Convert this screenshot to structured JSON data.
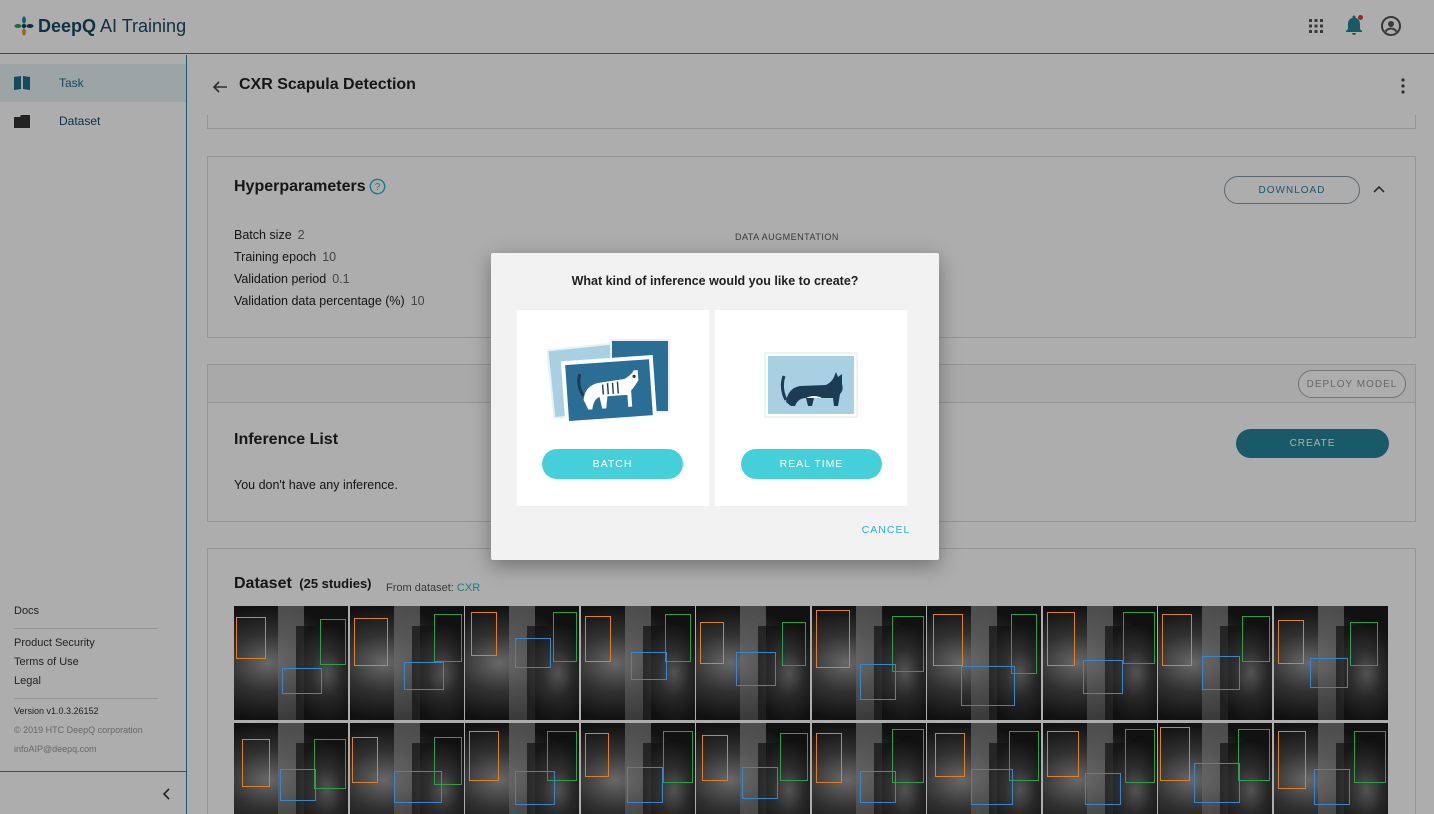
{
  "topbar": {
    "brand": "DeepQ",
    "product": "AI Training"
  },
  "sidebar": {
    "items": [
      {
        "label": "Task",
        "icon": "book-icon"
      },
      {
        "label": "Dataset",
        "icon": "folder-icon"
      }
    ],
    "links": [
      "Docs",
      "Product Security",
      "Terms of Use",
      "Legal"
    ],
    "version": "Version v1.0.3.26152",
    "copyright": "© 2019 HTC DeepQ corporation",
    "email": "infoAIP@deepq.com"
  },
  "header": {
    "title": "CXR Scapula Detection"
  },
  "hyperparameters": {
    "title": "Hyperparameters",
    "download_label": "DOWNLOAD",
    "params": [
      {
        "key": "Batch size",
        "value": "2"
      },
      {
        "key": "Training epoch",
        "value": "10"
      },
      {
        "key": "Validation period",
        "value": "0.1"
      },
      {
        "key": "Validation data percentage (%)",
        "value": "10"
      }
    ],
    "augmentation_label": "DATA AUGMENTATION"
  },
  "deploy": {
    "label": "DEPLOY MODEL"
  },
  "inference": {
    "title": "Inference List",
    "create_label": "CREATE",
    "empty_text": "You don't have any inference."
  },
  "dataset": {
    "title": "Dataset",
    "count": "(25 studies)",
    "from_label": "From dataset:",
    "from_value": "CXR"
  },
  "dialog": {
    "title": "What kind of inference would you like to create?",
    "batch_label": "BATCH",
    "realtime_label": "REAL TIME",
    "cancel_label": "CANCEL"
  },
  "colors": {
    "accent": "#27859a",
    "pill": "#45cfd8",
    "navy": "#174a64"
  }
}
